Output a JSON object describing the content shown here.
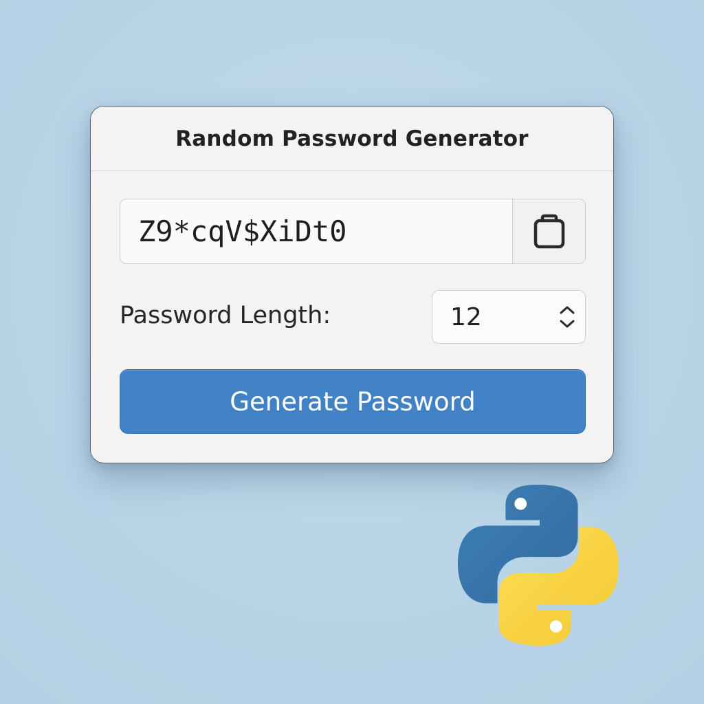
{
  "window": {
    "title": "Random Password Generator"
  },
  "password": {
    "value": "Z9*cqV$XiDt0",
    "copy_icon": "clipboard-icon"
  },
  "length": {
    "label": "Password Length:",
    "value": "12",
    "arrows_icon": "chevron-up-down-icon"
  },
  "generate": {
    "label": "Generate Password"
  },
  "logo": {
    "name": "python-logo",
    "colors": {
      "blue": "#3c79b0",
      "yellow": "#f8d44a"
    }
  },
  "colors": {
    "background": "#b9d4e7",
    "window": "#f3f3f3",
    "accent_button": "#4182c6",
    "button_text": "#ffffff"
  }
}
